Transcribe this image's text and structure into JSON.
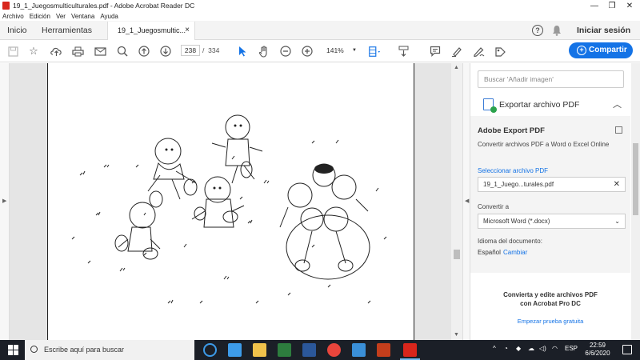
{
  "window": {
    "title": "19_1_Juegosmulticulturales.pdf - Adobe Acrobat Reader DC",
    "controls": {
      "minimize": "—",
      "restore": "❐",
      "close": "✕"
    }
  },
  "menu": [
    "Archivo",
    "Edición",
    "Ver",
    "Ventana",
    "Ayuda"
  ],
  "tabs": {
    "home": "Inicio",
    "tools": "Herramientas",
    "document": "19_1_Juegosmultic...",
    "close": "×"
  },
  "header": {
    "help": "?",
    "signin": "Iniciar sesión"
  },
  "toolbar": {
    "page_current": "238",
    "page_sep": "/",
    "page_total": "334",
    "zoom": "141%",
    "share_label": "Compartir"
  },
  "panel": {
    "search_placeholder": "Buscar 'Añadir imagen'",
    "export_title": "Exportar archivo PDF",
    "export_service": "Adobe Export PDF",
    "export_desc": "Convertir archivos PDF a Word o Excel Online",
    "select_file_label": "Seleccionar archivo PDF",
    "selected_file": "19_1_Juego...turales.pdf",
    "convert_to_label": "Convertir a",
    "convert_format": "Microsoft Word (*.docx)",
    "doc_language_label": "Idioma del documento:",
    "doc_language": "Español",
    "change_label": "Cambiar",
    "promo_line1": "Convierta y edite archivos PDF",
    "promo_line2": "con Acrobat Pro DC",
    "trial_label": "Empezar prueba gratuita"
  },
  "taskbar": {
    "search_placeholder": "Escribe aquí para buscar",
    "language": "ESP",
    "time": "22:59",
    "date": "6/6/2020"
  },
  "colors": {
    "accent": "#1473e6",
    "pdf_red": "#d8261c",
    "taskbar": "#1b1f27"
  }
}
